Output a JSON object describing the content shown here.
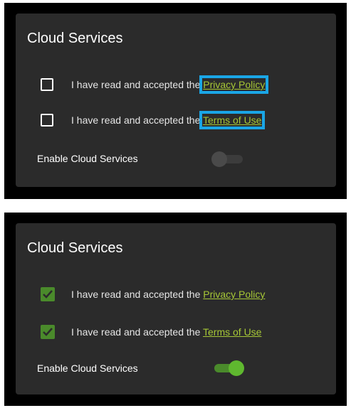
{
  "panels": [
    {
      "state": "before",
      "title": "Cloud Services",
      "rows": [
        {
          "checked": false,
          "text": "I have read and accepted the ",
          "link": "Privacy Policy"
        },
        {
          "checked": false,
          "text": "I have read and accepted the ",
          "link": "Terms of Use"
        }
      ],
      "toggle_label": "Enable Cloud Services",
      "toggle_on": false
    },
    {
      "state": "after",
      "title": "Cloud Services",
      "rows": [
        {
          "checked": true,
          "text": "I have read and accepted the ",
          "link": "Privacy Policy"
        },
        {
          "checked": true,
          "text": "I have read and accepted the ",
          "link": "Terms of Use"
        }
      ],
      "toggle_label": "Enable Cloud Services",
      "toggle_on": true
    }
  ],
  "colors": {
    "link": "#a6c736",
    "highlight": "#1aa6e6",
    "checked": "#4a8a2b",
    "toggle_on": "#5fb82f"
  }
}
